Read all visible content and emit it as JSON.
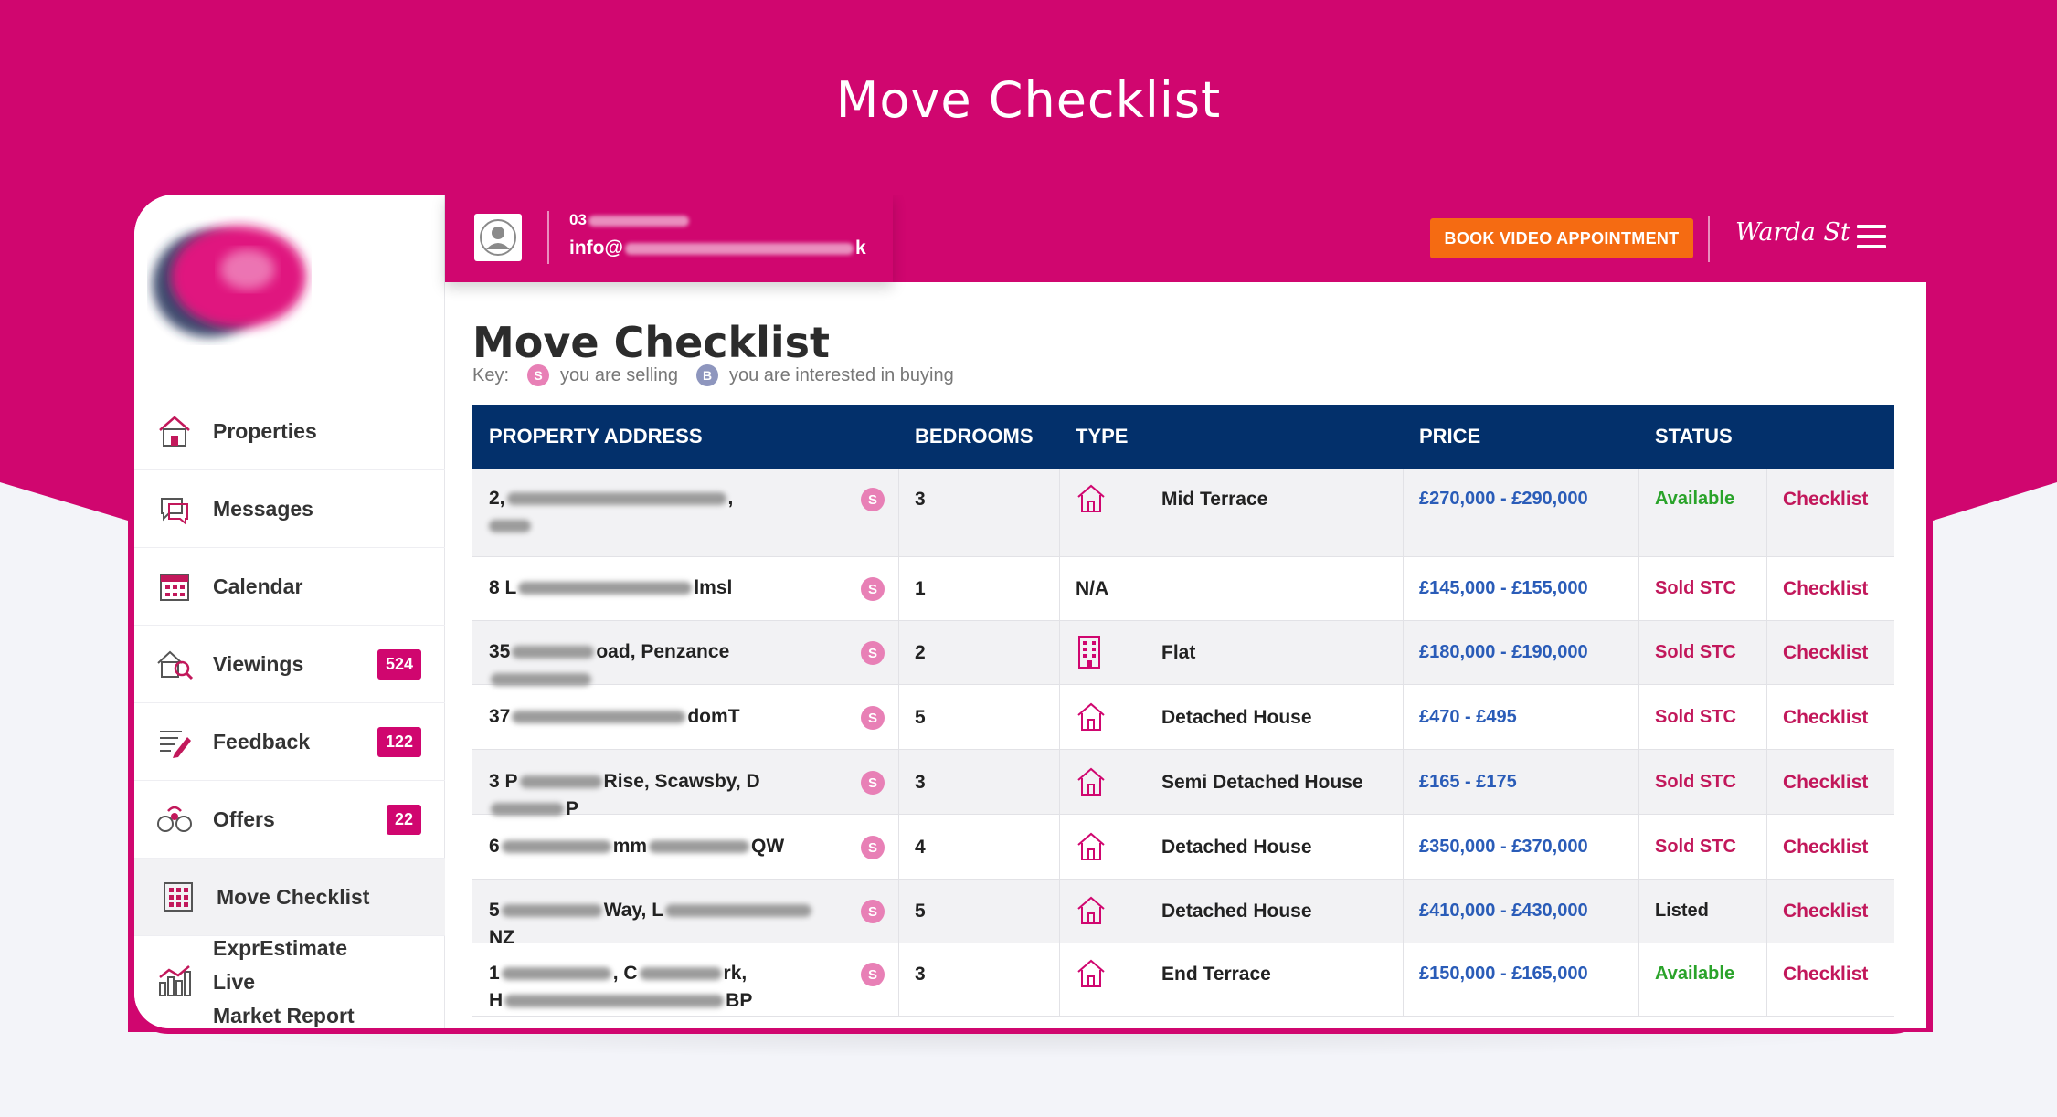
{
  "page": {
    "hero_title": "Move Checklist",
    "colors": {
      "brand": "#d0066f",
      "header_navy": "#03306b",
      "book_orange": "#f56b12",
      "available": "#2aa32a",
      "sold": "#c2185b",
      "price_blue": "#2a5cb8"
    }
  },
  "sidebar": {
    "items": [
      {
        "label": "Properties",
        "icon": "house-icon"
      },
      {
        "label": "Messages",
        "icon": "messages-icon"
      },
      {
        "label": "Calendar",
        "icon": "calendar-icon"
      },
      {
        "label": "Viewings",
        "icon": "viewings-icon",
        "badge": "524"
      },
      {
        "label": "Feedback",
        "icon": "feedback-icon",
        "badge": "122"
      },
      {
        "label": "Offers",
        "icon": "offers-icon",
        "badge": "22"
      },
      {
        "label": "Move Checklist",
        "icon": "checklist-icon",
        "active": true
      },
      {
        "label_line1": "ExprEstimate Live",
        "label_line2": "Market Report",
        "icon": "bar-chart-icon"
      }
    ]
  },
  "header": {
    "phone_prefix": "03",
    "email_prefix": "info@",
    "email_suffix": "k",
    "book_label": "BOOK VIDEO APPOINTMENT",
    "user_name": "Warda St"
  },
  "main": {
    "title": "Move Checklist",
    "key_label": "Key:",
    "key_selling_letter": "S",
    "key_selling": "you are selling",
    "key_buying_letter": "B",
    "key_buying": "you are interested in buying"
  },
  "table": {
    "columns": [
      "PROPERTY ADDRESS",
      "BEDROOMS",
      "TYPE",
      "PRICE",
      "STATUS"
    ],
    "rows": [
      {
        "addr1": "2,",
        "addr1_mid": ",",
        "addr2": "",
        "badge": "S",
        "beds": "3",
        "type": "Mid Terrace",
        "type_icon": "house-icon",
        "price": "£270,000 - £290,000",
        "status": "Available",
        "status_kind": "available",
        "action": "Checklist"
      },
      {
        "addr1": "8 L",
        "addr1_mid": "lmsl",
        "addr2": "",
        "badge": "S",
        "beds": "1",
        "type": "N/A",
        "type_icon": "",
        "price": "£145,000 - £155,000",
        "status": "Sold STC",
        "status_kind": "sold",
        "action": "Checklist"
      },
      {
        "addr1": "35",
        "addr1_mid": "oad, Penzance",
        "addr2": "",
        "badge": "S",
        "beds": "2",
        "type": "Flat",
        "type_icon": "building-icon",
        "price": "£180,000 - £190,000",
        "status": "Sold STC",
        "status_kind": "sold",
        "action": "Checklist"
      },
      {
        "addr1": "37",
        "addr1_mid": "dom",
        "addr1_end": "T",
        "addr2": "",
        "badge": "S",
        "beds": "5",
        "type": "Detached House",
        "type_icon": "house-icon",
        "price": "£470 - £495",
        "status": "Sold STC",
        "status_kind": "sold",
        "action": "Checklist"
      },
      {
        "addr1": "3 P",
        "addr1_mid": "Rise, Scawsby, D",
        "addr1_end": "P",
        "addr2": "",
        "badge": "S",
        "beds": "3",
        "type": "Semi Detached House",
        "type_icon": "house-icon",
        "price": "£165 - £175",
        "status": "Sold STC",
        "status_kind": "sold",
        "action": "Checklist"
      },
      {
        "addr1": "6",
        "addr1_mid": "mm",
        "addr1_end": "QW",
        "addr2": "",
        "badge": "S",
        "beds": "4",
        "type": "Detached House",
        "type_icon": "house-icon",
        "price": "£350,000 - £370,000",
        "status": "Sold STC",
        "status_kind": "sold",
        "action": "Checklist"
      },
      {
        "addr1": "5",
        "addr1_mid": "Way, L",
        "addr1_end": "NZ",
        "addr2": "",
        "badge": "S",
        "beds": "5",
        "type": "Detached House",
        "type_icon": "house-icon",
        "price": "£410,000 - £430,000",
        "status": "Listed",
        "status_kind": "listed",
        "action": "Checklist"
      },
      {
        "addr1": "1",
        "addr1_mid": ", C",
        "addr1_end": "rk,",
        "addr2": "H",
        "addr2_end": "BP",
        "badge": "S",
        "beds": "3",
        "type": "End Terrace",
        "type_icon": "house-icon",
        "price": "£150,000 - £165,000",
        "status": "Available",
        "status_kind": "available",
        "action": "Checklist"
      }
    ]
  }
}
